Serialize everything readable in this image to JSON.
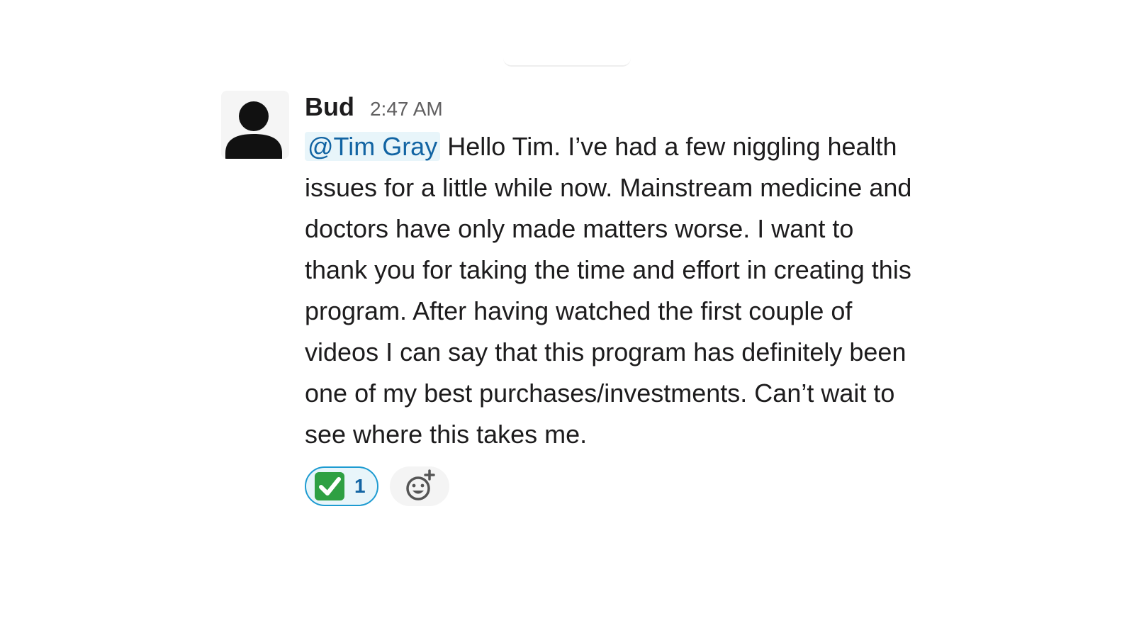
{
  "message": {
    "author": "Bud",
    "timestamp": "2:47 AM",
    "mention": "@Tim Gray",
    "text": " Hello Tim. I’ve had a few niggling health issues for a little while now. Mainstream medicine and doctors have only made matters worse. I want to thank you for taking the time and effort in creating this program. After having watched the first couple of videos I can say that this program has definitely been one of my best purchases/investments. Can’t wait to see where this takes me.",
    "avatar_icon": "default-user-icon"
  },
  "reactions": [
    {
      "emoji": "white-check-mark-icon",
      "count": "1"
    }
  ],
  "add_reaction_icon": "add-reaction-icon",
  "colors": {
    "mention_text": "#1264a3",
    "mention_bg": "#e8f5fa",
    "reaction_border": "#1d9bd1",
    "check_green": "#2ea043"
  }
}
